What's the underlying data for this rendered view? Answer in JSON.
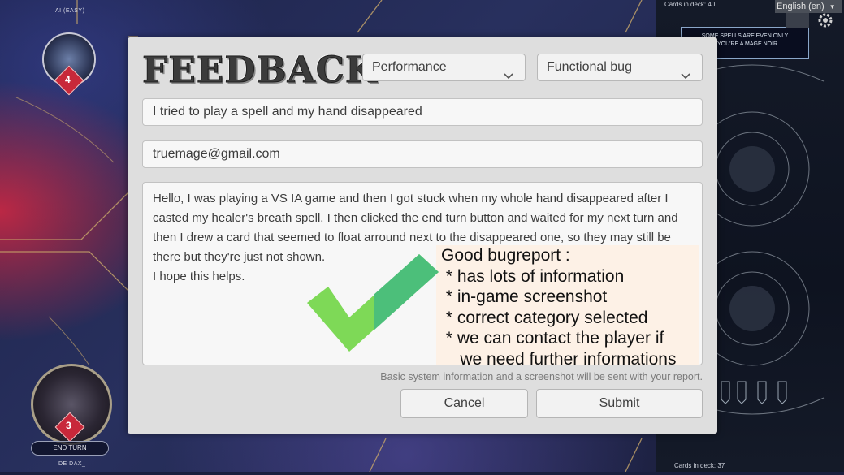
{
  "game": {
    "opponent_name": "AI (EASY)",
    "opponent_hp": "4",
    "player_hp": "3",
    "end_turn_label": "END TURN",
    "player_name": "DE DAX_",
    "opponent_deck_count": "Cards in deck: 40",
    "player_deck_count": "Cards in deck: 37",
    "tooltip_line1": "SOME SPELLS ARE EVEN ONLY",
    "tooltip_line2": "IF YOU'RE A MAGE NOIR.",
    "language_select": "English (en)"
  },
  "dialog": {
    "title": "FEEDBACK",
    "category_select": "Performance",
    "type_select": "Functional bug",
    "subject_value": "I tried to play a spell and my hand disappeared",
    "email_value": "truemage@gmail.com",
    "message_value": "Hello, I was playing a VS IA game and then I got stuck when my whole hand disappeared after I casted my healer's breath spell. I then clicked the end turn button and waited for my next turn and then I drew a card that seemed to float arround next to the disappeared one, so they may still be there but they're just not shown.\nI hope this helps.",
    "system_note": "Basic system information and a screenshot will be sent with your report.",
    "cancel_label": "Cancel",
    "submit_label": "Submit"
  },
  "annotation": {
    "heading": "Good bugreport :",
    "points": [
      " * has lots of information",
      " * in-game screenshot",
      " * correct category selected",
      " * we can contact the player if",
      "    we need further informations"
    ],
    "check_color": "#7ed957",
    "check_shade": "#4cbf7a"
  }
}
